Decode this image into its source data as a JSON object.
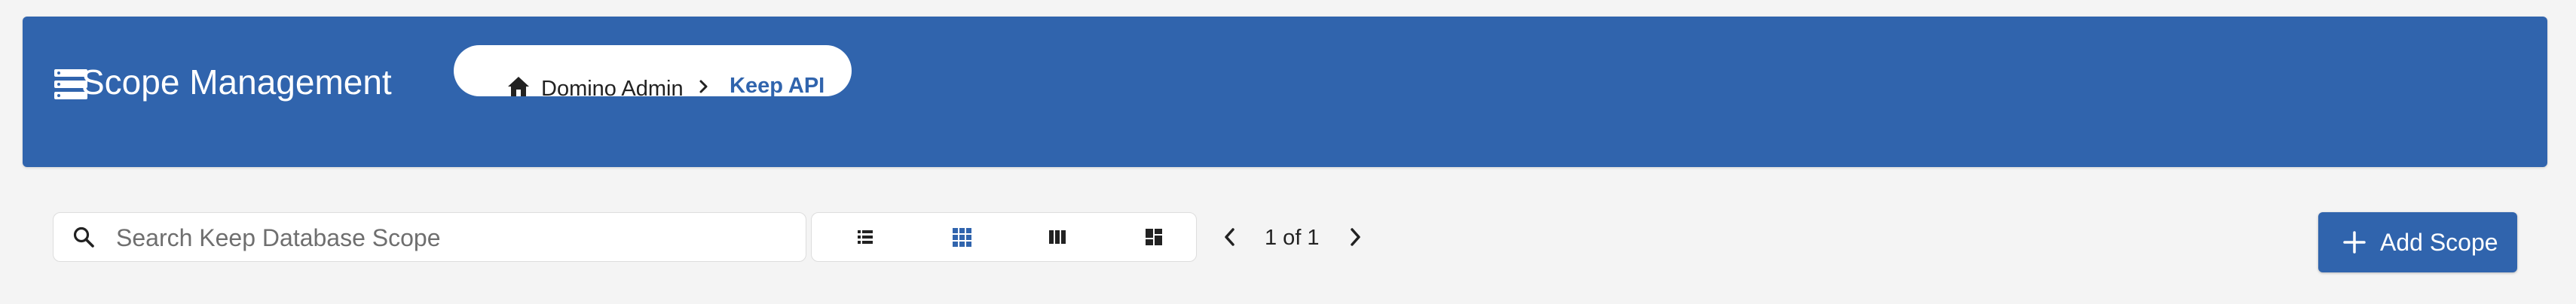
{
  "header": {
    "title": "Scope Management",
    "icon": "server-list-icon",
    "breadcrumb": {
      "home_icon": "home-icon",
      "items": [
        "Domino Admin",
        "Keep API"
      ],
      "separator_icon": "chevron-right-icon"
    }
  },
  "toolbar": {
    "search": {
      "placeholder": "Search Keep Database Scope",
      "value": ""
    },
    "view_modes": [
      {
        "icon": "list-view-icon",
        "selected": false
      },
      {
        "icon": "grid-view-icon",
        "selected": true
      },
      {
        "icon": "column-view-icon",
        "selected": false
      },
      {
        "icon": "dashboard-view-icon",
        "selected": false
      }
    ],
    "pagination": {
      "text": "1 of 1",
      "current_page": 1,
      "total_pages": 1
    },
    "add_button": {
      "label": "Add Scope",
      "icon": "plus-icon"
    }
  },
  "colors": {
    "brand": "#3064ad",
    "background": "#f4f4f4",
    "icon_inactive": "#222222",
    "icon_active": "#3064ad"
  }
}
